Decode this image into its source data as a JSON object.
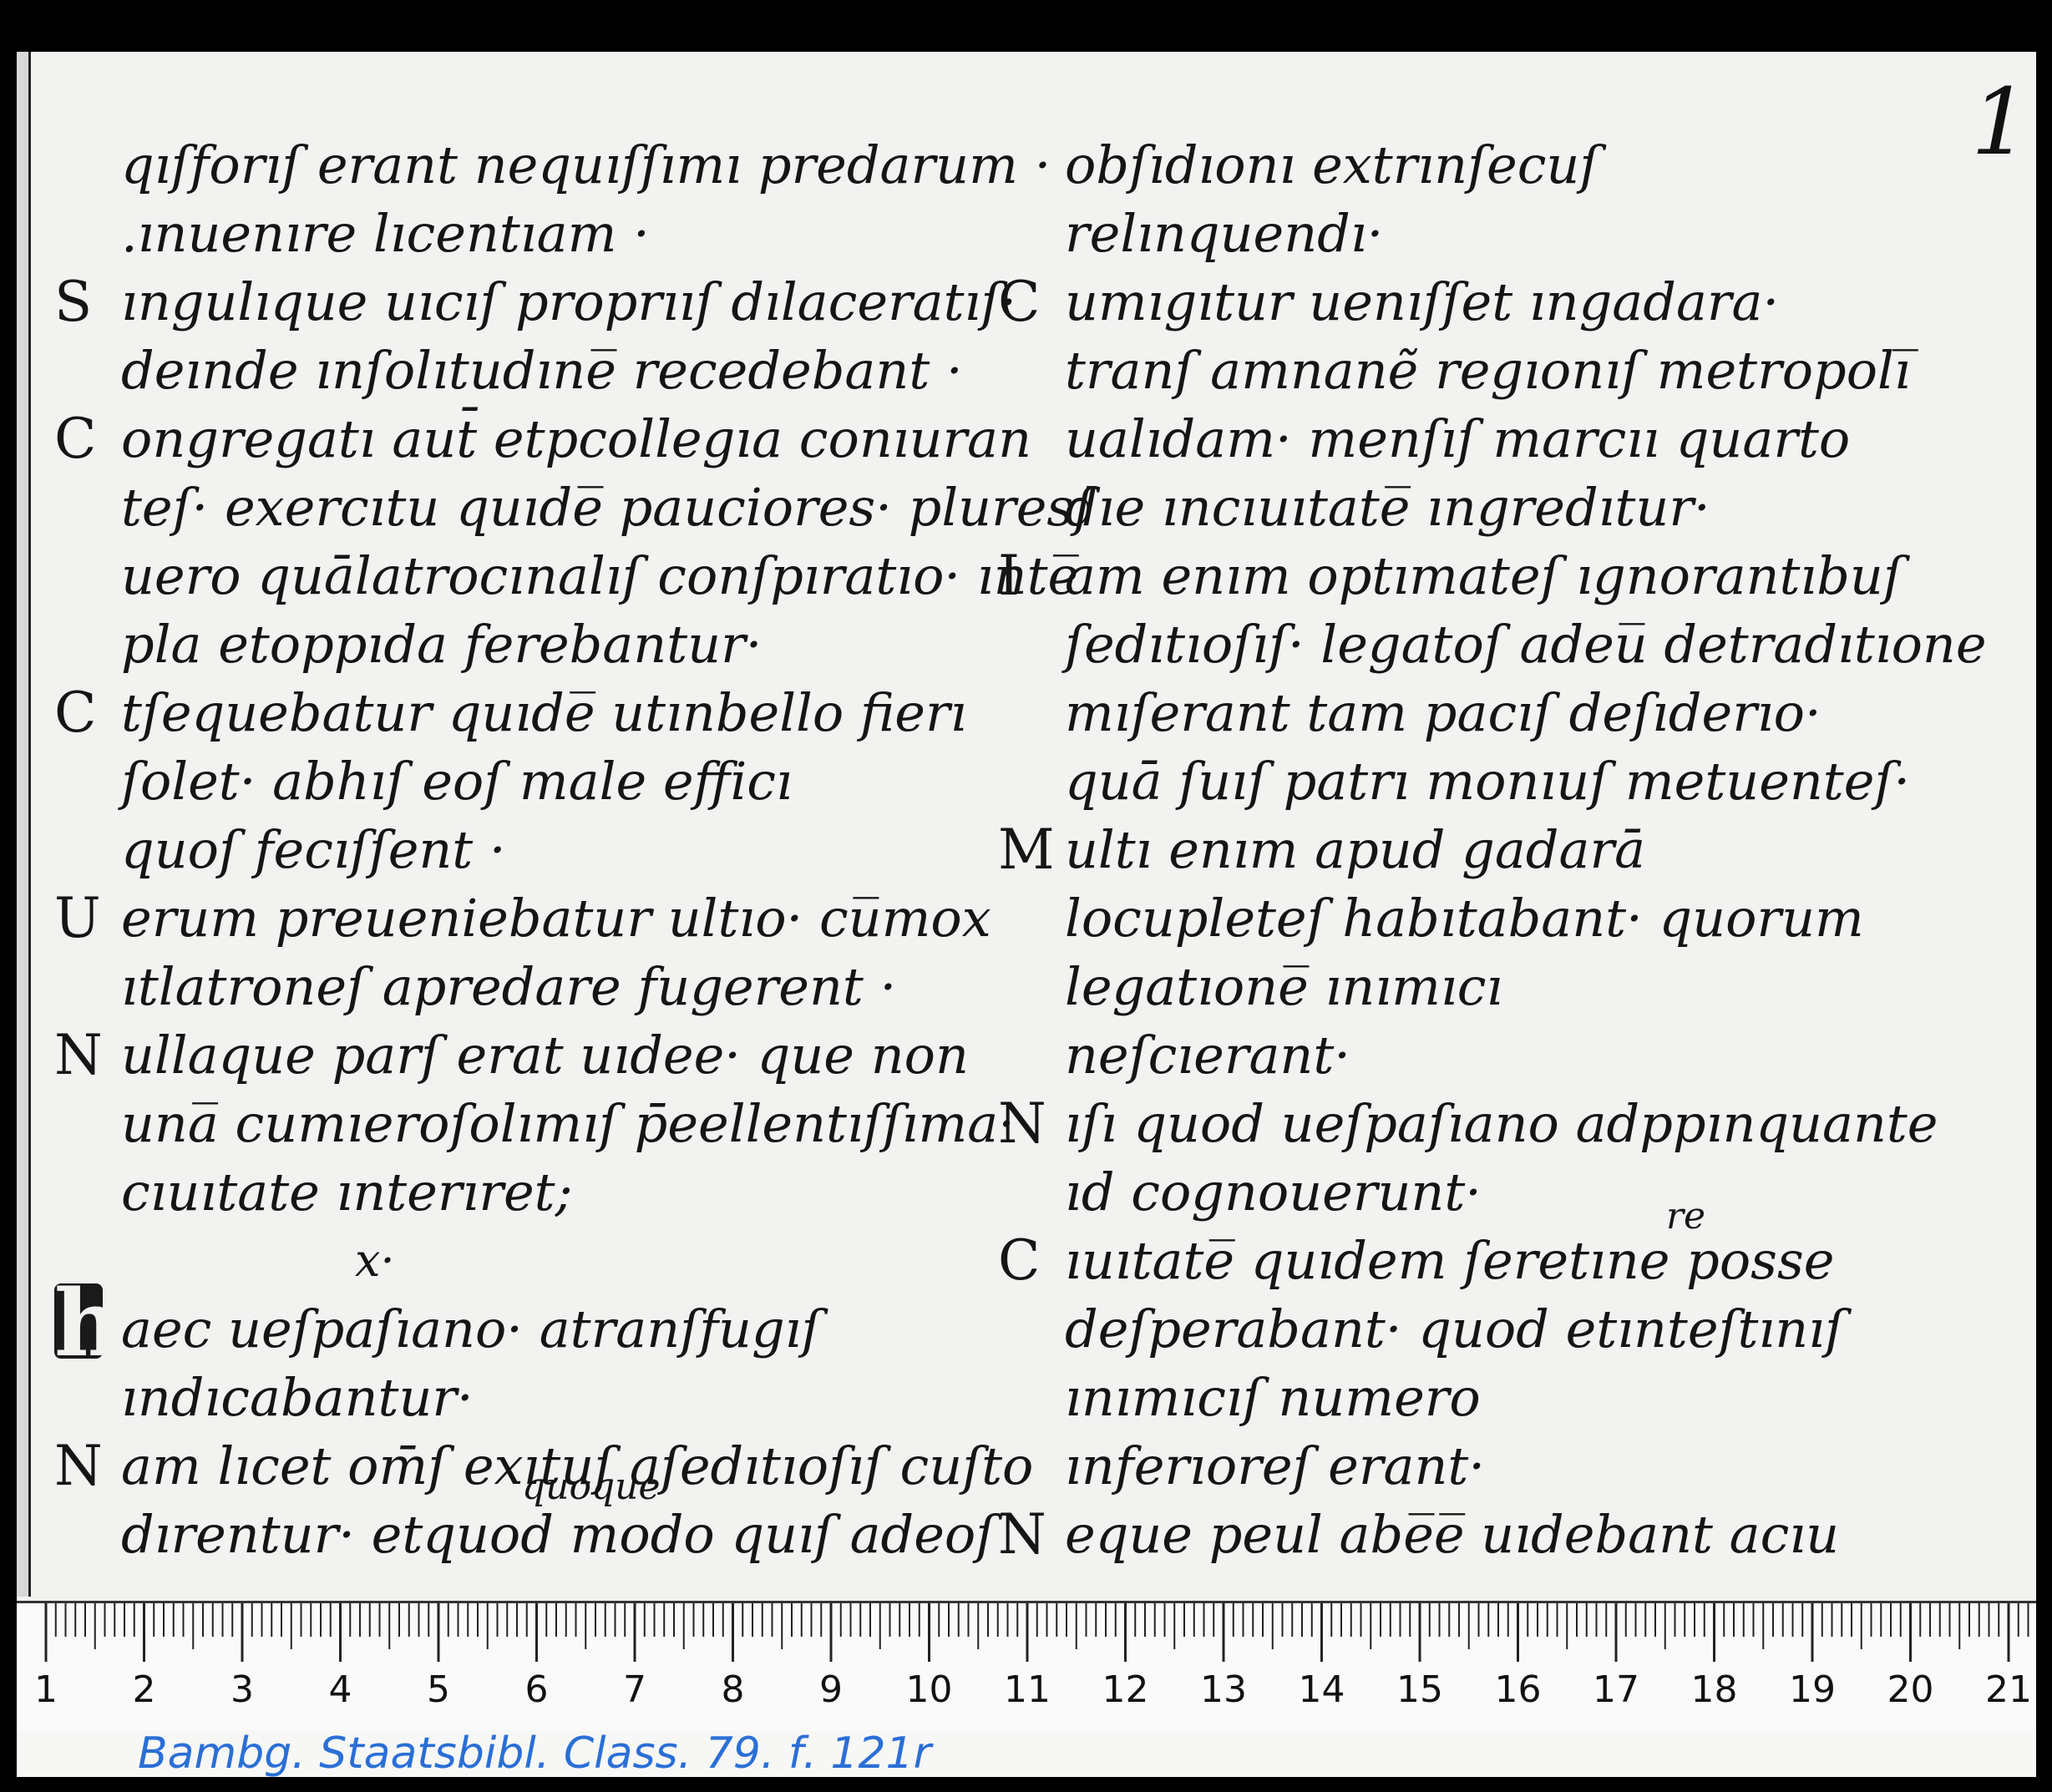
{
  "page_number": "1",
  "left_column": [
    {
      "initial": "",
      "text": "qıſforıſ erant nequıſſımı predarum ·"
    },
    {
      "initial": "",
      "text": ".ınuenıre lıcentıam ·"
    },
    {
      "initial": "S",
      "text": "ıngulıque uıcıſ proprııſ dılaceratıſ·"
    },
    {
      "initial": "",
      "text": "deınde ınſolıtudıne̅ recedebant ·"
    },
    {
      "initial": "C",
      "text": "ongregatı aut̄ etpcollegıa conıuran"
    },
    {
      "initial": "",
      "text": "teſ· exercıtu quıde̅ pauciores· pluresſ"
    },
    {
      "initial": "",
      "text": "uero quālatrocınalıſ conſpıratıo· ınte̅"
    },
    {
      "initial": "",
      "text": "pla etoppıda ferebantur·"
    },
    {
      "initial": "C",
      "text": "tſequebatur quıde̅ utınbello fierı"
    },
    {
      "initial": "",
      "text": "ſolet· abhıſ eoſ male efficı"
    },
    {
      "initial": "",
      "text": "quoſ fecıſſent ·"
    },
    {
      "initial": "U",
      "text": "erum preueniebatur ultıo· cu̅mox"
    },
    {
      "initial": "",
      "text": "ıtlatroneſ apredare fugerent ·"
    },
    {
      "initial": "N",
      "text": "ullaque parſ erat uıdee· que non"
    },
    {
      "initial": "",
      "text": "una̅ cumıeroſolımıſ p̄eellentıſſıma·"
    },
    {
      "initial": "",
      "text": "cıuıtate ınterıret;"
    }
  ],
  "left_gloss_x": "x·",
  "left_column_after": [
    {
      "initial": "h",
      "text": "aec ueſpaſıano· atranſfugıſ",
      "big": true
    },
    {
      "initial": "",
      "text": "ındıcabantur·"
    },
    {
      "initial": "N",
      "text": "am lıcet om̄ſ exıtuſ aſedıtıoſıſ cuſto"
    },
    {
      "initial": "",
      "text": "dırentur· etquod modo quıſ adeoſ"
    }
  ],
  "left_gloss_quoque": "quoque",
  "right_column": [
    {
      "initial": "",
      "text": "obſıdıonı extrınſecuſ"
    },
    {
      "initial": "",
      "text": "relınquendı·"
    },
    {
      "initial": "C",
      "text": "umıgıtur uenıſſet ıngadara·"
    },
    {
      "initial": "",
      "text": "tranſ amnanẽ regıonıſ metropolı̅"
    },
    {
      "initial": "",
      "text": "ualıdam· menſıſ marcıı quarto"
    },
    {
      "initial": "",
      "text": "dıe ıncıuıtate̅ ıngredıtur·"
    },
    {
      "initial": "I",
      "text": "am enım optımateſ ıgnorantıbuſ"
    },
    {
      "initial": "",
      "text": "ſedıtıoſıſ· legatoſ adeu̅ detradıtıone"
    },
    {
      "initial": "",
      "text": "mıſerant tam pacıſ deſıderıo·"
    },
    {
      "initial": "",
      "text": "quā ſuıſ patrı monıuſ metuenteſ·"
    },
    {
      "initial": "M",
      "text": "ultı enım apud gadarā"
    },
    {
      "initial": "",
      "text": "locupleteſ habıtabant· quorum"
    },
    {
      "initial": "",
      "text": "legatıone̅ ınımıcı"
    },
    {
      "initial": "",
      "text": "neſcıerant·"
    },
    {
      "initial": "N",
      "text": "ıſı quod ueſpaſıano adppınquante"
    },
    {
      "initial": "",
      "text": "ıd cognouerunt·"
    },
    {
      "initial": "C",
      "text": "ıuıtate̅ quıdem ſeretıne posse"
    },
    {
      "initial": "",
      "text": "deſperabant· quod etınteſtınıſ"
    },
    {
      "initial": "",
      "text": "ınımıcıſ numero"
    },
    {
      "initial": "",
      "text": "ınferıoreſ erant·"
    },
    {
      "initial": "N",
      "text": "eque peul abe̅e̅ uıdebant acıu"
    }
  ],
  "right_gloss_re": "re",
  "ruler": {
    "labels": [
      "1",
      "2",
      "3",
      "4",
      "5",
      "6",
      "7",
      "8",
      "9",
      "10",
      "11",
      "12",
      "13",
      "14",
      "15",
      "16",
      "17",
      "18",
      "19",
      "20",
      "21"
    ]
  },
  "shelfmark": "Bambg. Staatsbibl. Class. 79. f. 121r"
}
